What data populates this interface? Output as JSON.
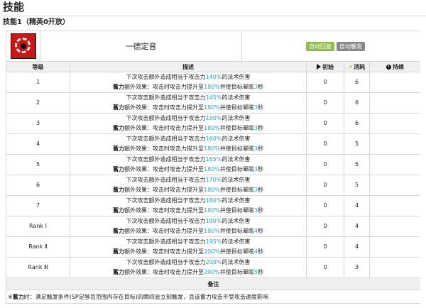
{
  "page_title": "技能",
  "skill_subtitle": "技能1（精英0开放）",
  "skill": {
    "name": "一德定音",
    "tags": [
      "自动回复",
      "自动触发"
    ]
  },
  "columns": {
    "level": "等级",
    "desc": "描述",
    "initial": "初始",
    "cost": "消耗",
    "duration": "持续"
  },
  "rows": [
    {
      "level": "1",
      "line1_pre": "下次攻击额外造成相当于攻击力",
      "line1_pct": "140%",
      "line1_post": "的法术伤害",
      "kw": "蓄力",
      "line2_pre": "额外效果：攻击时攻击力提升至",
      "line2_pct": "180%",
      "line2_mid": "并使目标晕眩",
      "line2_sec": "3",
      "line2_post": "秒",
      "initial": "0",
      "cost": "6",
      "duration": ""
    },
    {
      "level": "2",
      "line1_pre": "下次攻击额外造成相当于攻击力",
      "line1_pct": "145%",
      "line1_post": "的法术伤害",
      "kw": "蓄力",
      "line2_pre": "额外效果：攻击时攻击力提升至",
      "line2_pct": "180%",
      "line2_mid": "并使目标晕眩",
      "line2_sec": "3",
      "line2_post": "秒",
      "initial": "0",
      "cost": "6",
      "duration": ""
    },
    {
      "level": "3",
      "line1_pre": "下次攻击额外造成相当于攻击力",
      "line1_pct": "150%",
      "line1_post": "的法术伤害",
      "kw": "蓄力",
      "line2_pre": "额外效果：攻击时攻击力提升至",
      "line2_pct": "180%",
      "line2_mid": "并使目标晕眩",
      "line2_sec": "3",
      "line2_post": "秒",
      "initial": "0",
      "cost": "6",
      "duration": ""
    },
    {
      "level": "4",
      "line1_pre": "下次攻击额外造成相当于攻击力",
      "line1_pct": "160%",
      "line1_post": "的法术伤害",
      "kw": "蓄力",
      "line2_pre": "额外效果：攻击时攻击力提升至",
      "line2_pct": "180%",
      "line2_mid": "并使目标晕眩",
      "line2_sec": "3",
      "line2_post": "秒",
      "initial": "0",
      "cost": "5",
      "duration": ""
    },
    {
      "level": "5",
      "line1_pre": "下次攻击额外造成相当于攻击力",
      "line1_pct": "165%",
      "line1_post": "的法术伤害",
      "kw": "蓄力",
      "line2_pre": "额外效果：攻击时攻击力提升至",
      "line2_pct": "180%",
      "line2_mid": "并使目标晕眩",
      "line2_sec": "3",
      "line2_post": "秒",
      "initial": "0",
      "cost": "5",
      "duration": ""
    },
    {
      "level": "6",
      "line1_pre": "下次攻击额外造成相当于攻击力",
      "line1_pct": "170%",
      "line1_post": "的法术伤害",
      "kw": "蓄力",
      "line2_pre": "额外效果：攻击时攻击力提升至",
      "line2_pct": "180%",
      "line2_mid": "并使目标晕眩",
      "line2_sec": "3",
      "line2_post": "秒",
      "initial": "0",
      "cost": "5",
      "duration": ""
    },
    {
      "level": "7",
      "line1_pre": "下次攻击额外造成相当于攻击力",
      "line1_pct": "180%",
      "line1_post": "的法术伤害",
      "kw": "蓄力",
      "line2_pre": "额外效果：攻击时攻击力提升至",
      "line2_pct": "180%",
      "line2_mid": "并使目标晕眩",
      "line2_sec": "3",
      "line2_post": "秒",
      "initial": "0",
      "cost": "4",
      "duration": ""
    },
    {
      "level": "Rank Ⅰ",
      "line1_pre": "下次攻击额外造成相当于攻击力",
      "line1_pct": "190%",
      "line1_post": "的法术伤害",
      "kw": "蓄力",
      "line2_pre": "额外效果：攻击时攻击力提升至",
      "line2_pct": "180%",
      "line2_mid": "并使目标晕眩",
      "line2_sec": "4",
      "line2_post": "秒",
      "initial": "0",
      "cost": "4",
      "duration": ""
    },
    {
      "level": "Rank Ⅱ",
      "line1_pre": "下次攻击额外造成相当于攻击力",
      "line1_pct": "195%",
      "line1_post": "的法术伤害",
      "kw": "蓄力",
      "line2_pre": "额外效果：攻击时攻击力提升至",
      "line2_pct": "200%",
      "line2_mid": "并使目标晕眩",
      "line2_sec": "4",
      "line2_post": "秒",
      "initial": "0",
      "cost": "4",
      "duration": ""
    },
    {
      "level": "Rank Ⅲ",
      "line1_pre": "下次攻击额外造成相当于攻击力",
      "line1_pct": "200%",
      "line1_post": "的法术伤害",
      "kw": "蓄力",
      "line2_pre": "额外效果：攻击时攻击力提升至",
      "line2_pct": "200%",
      "line2_mid": "并使目标晕眩",
      "line2_sec": "5",
      "line2_post": "秒",
      "initial": "0",
      "cost": "3",
      "duration": ""
    }
  ],
  "notes": {
    "header": "备注",
    "prefix": "※",
    "kw": "蓄力",
    "text": "时：满足触发条件(SP足够且范围内存在目标)的瞬间会立刻触发，且该蓄力攻击不受攻击速度影响"
  }
}
